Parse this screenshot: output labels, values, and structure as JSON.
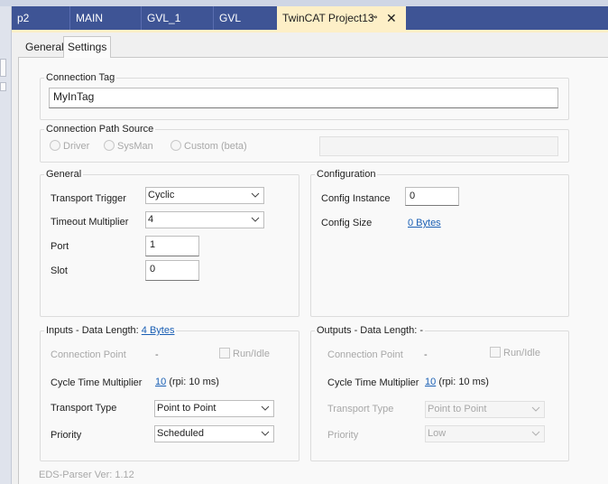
{
  "doc_tabs": [
    {
      "label": "p2"
    },
    {
      "label": "MAIN"
    },
    {
      "label": "GVL_1"
    },
    {
      "label": "GVL"
    },
    {
      "label": "TwinCAT Project13",
      "pin": "⊸",
      "close": "✕",
      "active": true
    }
  ],
  "page_tabs": {
    "general": "General",
    "settings": "Settings"
  },
  "connection_tag": {
    "title": "Connection Tag",
    "value": "MyInTag"
  },
  "connection_path": {
    "title": "Connection Path Source",
    "options": [
      "Driver",
      "SysMan",
      "Custom (beta)"
    ],
    "value": ""
  },
  "general": {
    "title": "General",
    "transport_trigger": {
      "label": "Transport Trigger",
      "value": "Cyclic"
    },
    "timeout_multiplier": {
      "label": "Timeout Multiplier",
      "value": "4"
    },
    "port": {
      "label": "Port",
      "value": "1"
    },
    "slot": {
      "label": "Slot",
      "value": "0"
    }
  },
  "configuration": {
    "title": "Configuration",
    "config_instance": {
      "label": "Config Instance",
      "value": "0"
    },
    "config_size": {
      "label": "Config Size",
      "value": "0 Bytes"
    }
  },
  "inputs": {
    "title_prefix": "Inputs - Data Length:",
    "data_length": "4 Bytes",
    "connection_point": {
      "label": "Connection Point",
      "value": "-"
    },
    "run_idle": "Run/Idle",
    "cycle_time_multiplier": {
      "label": "Cycle Time Multiplier",
      "value": "10",
      "rpi": "(rpi: 10 ms)"
    },
    "transport_type": {
      "label": "Transport Type",
      "value": "Point to Point"
    },
    "priority": {
      "label": "Priority",
      "value": "Scheduled"
    }
  },
  "outputs": {
    "title": "Outputs - Data Length: -",
    "connection_point": {
      "label": "Connection Point",
      "value": "-"
    },
    "run_idle": "Run/Idle",
    "cycle_time_multiplier": {
      "label": "Cycle Time Multiplier",
      "value": "10",
      "rpi": "(rpi: 10 ms)"
    },
    "transport_type": {
      "label": "Transport Type",
      "value": "Point to Point"
    },
    "priority": {
      "label": "Priority",
      "value": "Low"
    }
  },
  "footer": {
    "version": "EDS-Parser Ver: 1.12"
  },
  "colors": {
    "tab_bar": "#3e5495",
    "active_tab": "#fdefc7",
    "link": "#1a5fb4"
  }
}
